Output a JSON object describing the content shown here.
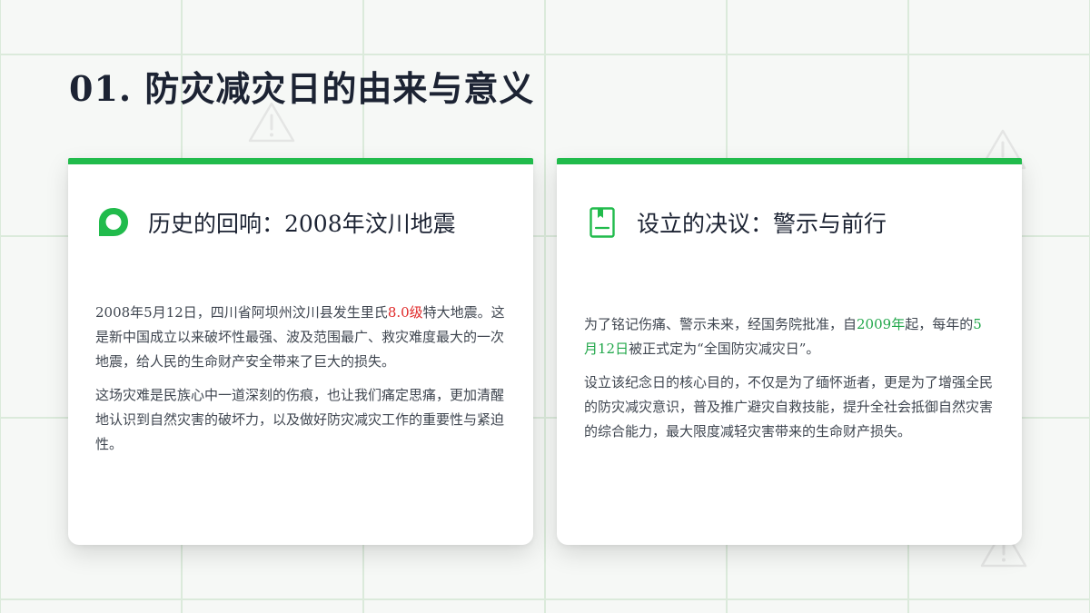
{
  "colors": {
    "accent": "#21bb4c",
    "highlight_red": "#e02929",
    "highlight_green": "#21a74a",
    "title": "#1c2333",
    "text": "#3f4650"
  },
  "page": {
    "title": "01. 防灾减灾日的由来与意义"
  },
  "left_card": {
    "icon": "speech-bubble-icon",
    "title": "历史的回响：2008年汶川地震",
    "p1_pre": "2008年5月12日，四川省阿坝州汶川县发生里氏",
    "p1_highlight": "8.0级",
    "p1_post": "特大地震。这是新中国成立以来破坏性最强、波及范围最广、救灾难度最大的一次地震，给人民的生命财产安全带来了巨大的损失。",
    "p2": "这场灾难是民族心中一道深刻的伤痕，也让我们痛定思痛，更加清醒地认识到自然灾害的破坏力，以及做好防灾减灾工作的重要性与紧迫性。"
  },
  "right_card": {
    "icon": "book-icon",
    "title": "设立的决议：警示与前行",
    "p1_a": "为了铭记伤痛、警示未来，经国务院批准，自",
    "p1_hl1": "2009年",
    "p1_b": "起，每年的",
    "p1_hl2": "5月12日",
    "p1_c": "被正式定为“全国防灾减灾日”。",
    "p2": "设立该纪念日的核心目的，不仅是为了缅怀逝者，更是为了增强全民的防灾减灾意识，普及推广避灾自救技能，提升全社会抵御自然灾害的综合能力，最大限度减轻灾害带来的生命财产损失。"
  }
}
